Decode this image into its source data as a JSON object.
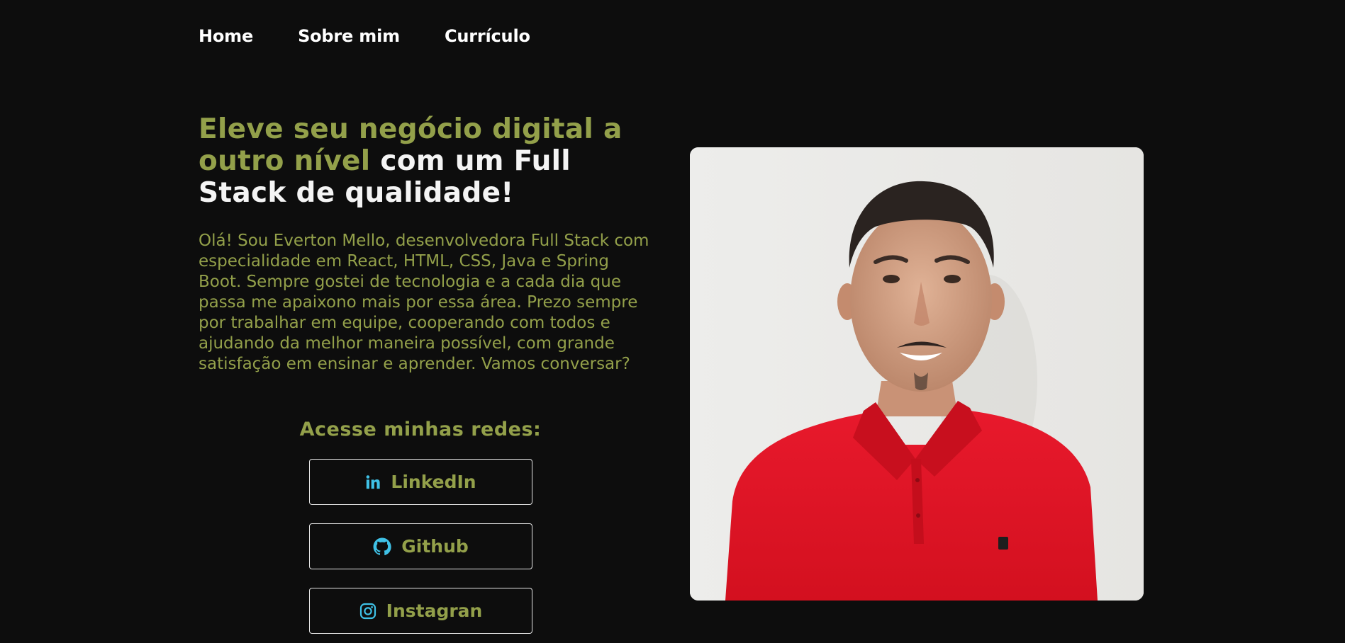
{
  "nav": {
    "items": [
      {
        "label": "Home"
      },
      {
        "label": "Sobre mim"
      },
      {
        "label": "Currículo"
      }
    ]
  },
  "hero": {
    "title_accent": "Eleve seu negócio digital a outro nível",
    "title_rest": " com um Full Stack de qualidade!",
    "bio": "Olá! Sou Everton Mello, desenvolvedora Full Stack com especialidade em React, HTML, CSS, Java e Spring Boot. Sempre gostei de tecnologia e a cada dia que passa me apaixono mais por essa área. Prezo sempre por trabalhar em equipe, cooperando com todos e ajudando da melhor maneira possível, com grande satisfação em ensinar e aprender. Vamos conversar?"
  },
  "social": {
    "title": "Acesse minhas redes:",
    "links": [
      {
        "label": "LinkedIn",
        "icon": "linkedin-icon"
      },
      {
        "label": "Github",
        "icon": "github-icon"
      },
      {
        "label": "Instagran",
        "icon": "instagram-icon"
      }
    ]
  },
  "colors": {
    "background": "#0d0d0d",
    "accent": "#93a04a",
    "icon": "#3fc1e6",
    "text": "#ffffff"
  },
  "photo": {
    "subject": "profile-photo"
  }
}
